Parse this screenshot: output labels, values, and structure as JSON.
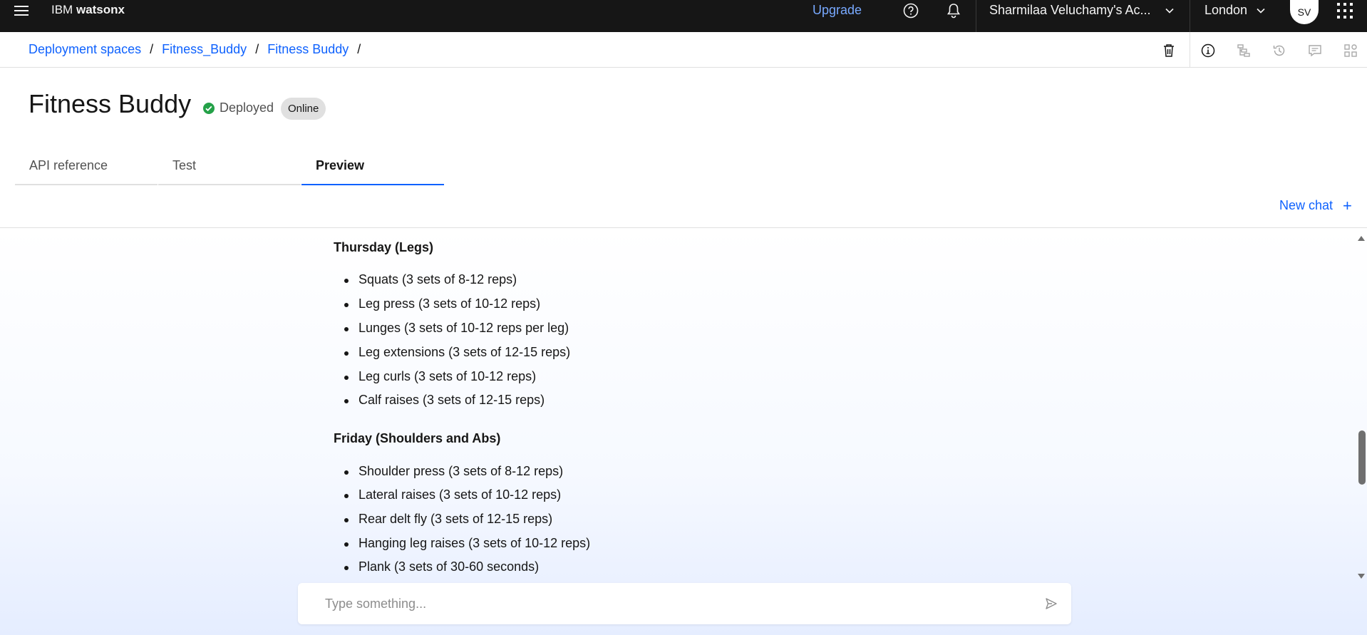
{
  "topbar": {
    "brand_prefix": "IBM",
    "brand_name": "watsonx",
    "upgrade_label": "Upgrade",
    "account_label": "Sharmilaa Veluchamy's Ac...",
    "region_label": "London",
    "avatar_initials": "SV",
    "icons": [
      "hamburger-menu-icon",
      "help-icon",
      "notification-bell-icon",
      "chevron-down-icon",
      "app-switcher-icon"
    ]
  },
  "breadcrumb": {
    "items": [
      "Deployment spaces",
      "Fitness_Buddy",
      "Fitness Buddy"
    ],
    "separator": "/"
  },
  "toolbar": {
    "icons": [
      "trash-icon",
      "info-icon",
      "hierarchy-icon",
      "history-icon",
      "comment-icon",
      "grid-icon"
    ]
  },
  "page": {
    "title": "Fitness Buddy",
    "status": "Deployed",
    "status_color": "#24a148",
    "badge": "Online"
  },
  "tabs": [
    {
      "label": "API reference",
      "active": false
    },
    {
      "label": "Test",
      "active": false
    },
    {
      "label": "Preview",
      "active": true
    }
  ],
  "new_chat_label": "New chat",
  "new_chat_icon": "+",
  "chat": {
    "sections": [
      {
        "title": "Thursday (Legs)",
        "items": [
          "Squats (3 sets of 8-12 reps)",
          "Leg press (3 sets of 10-12 reps)",
          "Lunges (3 sets of 10-12 reps per leg)",
          "Leg extensions (3 sets of 12-15 reps)",
          "Leg curls (3 sets of 10-12 reps)",
          "Calf raises (3 sets of 12-15 reps)"
        ]
      },
      {
        "title": "Friday (Shoulders and Abs)",
        "items": [
          "Shoulder press (3 sets of 8-12 reps)",
          "Lateral raises (3 sets of 10-12 reps)",
          "Rear delt fly (3 sets of 12-15 reps)",
          "Hanging leg raises (3 sets of 10-12 reps)",
          "Plank (3 sets of 30-60 seconds)"
        ]
      }
    ]
  },
  "input": {
    "placeholder": "Type something...",
    "value": "",
    "send_icon": "send-icon"
  },
  "colors": {
    "accent": "#0f62fe",
    "topbar_bg": "#161616",
    "upgrade_link": "#78a9ff"
  }
}
